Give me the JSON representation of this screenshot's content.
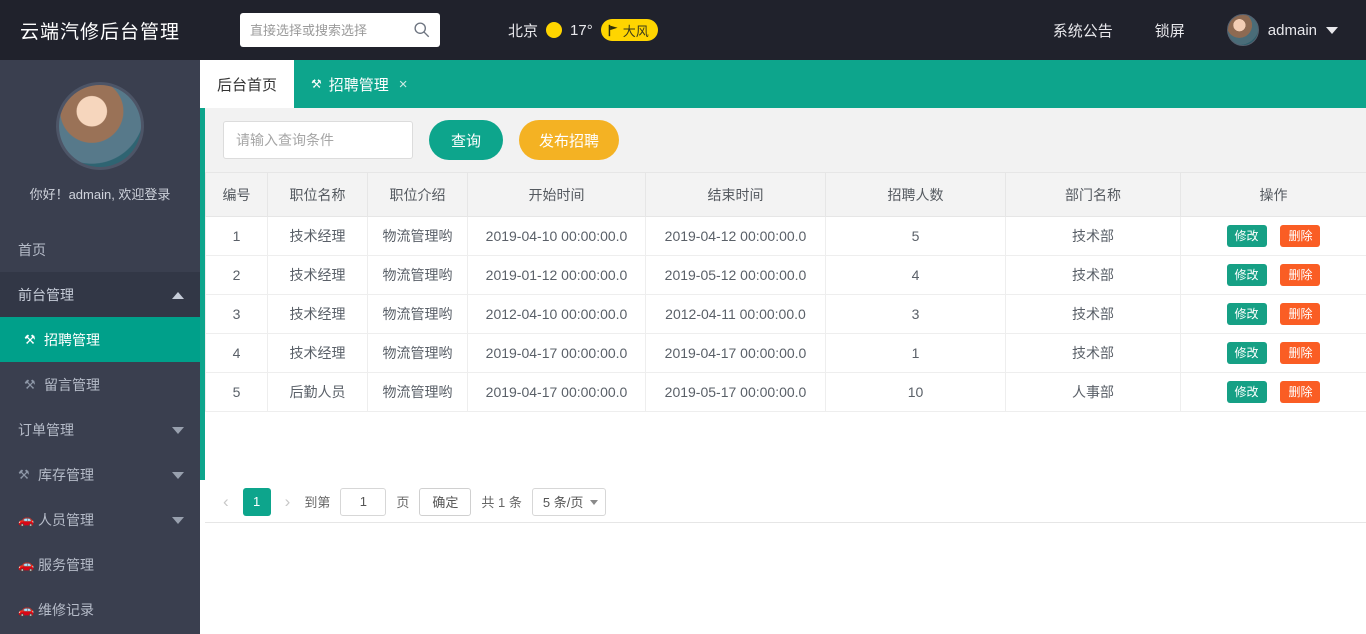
{
  "topbar": {
    "brand": "云端汽修后台管理",
    "search": {
      "value": "",
      "placeholder": "直接选择或搜索选择",
      "icon": "search-icon"
    },
    "weather": {
      "city": "北京",
      "sun_icon": "sun-icon",
      "temperature": "17°",
      "badge_icon": "flag-icon",
      "badge": "大风"
    },
    "notice": "系统公告",
    "lock": "锁屏",
    "user": "admain",
    "caret": "chevron-down-icon"
  },
  "sidebar": {
    "greeting": "你好！admain, 欢迎登录",
    "items": [
      {
        "label": "首页",
        "icon": "",
        "state": "plain",
        "arrow": ""
      },
      {
        "label": "前台管理",
        "icon": "",
        "state": "group",
        "arrow": "up"
      },
      {
        "label": "招聘管理",
        "icon": "tools-icon",
        "state": "active-sub",
        "arrow": ""
      },
      {
        "label": "留言管理",
        "icon": "tools-icon",
        "state": "sub",
        "arrow": ""
      },
      {
        "label": "订单管理",
        "icon": "",
        "state": "plain",
        "arrow": "down"
      },
      {
        "label": "库存管理",
        "icon": "tools-icon",
        "state": "plain",
        "arrow": "down"
      },
      {
        "label": "人员管理",
        "icon": "car-icon",
        "state": "plain",
        "arrow": "down"
      },
      {
        "label": "服务管理",
        "icon": "car-icon",
        "state": "plain",
        "arrow": ""
      },
      {
        "label": "维修记录",
        "icon": "car-icon",
        "state": "plain",
        "arrow": ""
      }
    ]
  },
  "tabs": [
    {
      "label": "后台首页",
      "active": false,
      "icon": "",
      "closable": false
    },
    {
      "label": "招聘管理",
      "active": true,
      "icon": "tools-icon",
      "closable": true,
      "close": "×"
    }
  ],
  "toolbar": {
    "query_value": "",
    "query_placeholder": "请输入查询条件",
    "search_label": "查询",
    "publish_label": "发布招聘"
  },
  "table": {
    "columns": [
      "编号",
      "职位名称",
      "职位介绍",
      "开始时间",
      "结束时间",
      "招聘人数",
      "部门名称",
      "操作"
    ],
    "rows": [
      {
        "id": "1",
        "position": "技术经理",
        "intro": "物流管理哟",
        "start": "2019-04-10 00:00:00.0",
        "end": "2019-04-12 00:00:00.0",
        "count": "5",
        "dept": "技术部"
      },
      {
        "id": "2",
        "position": "技术经理",
        "intro": "物流管理哟",
        "start": "2019-01-12 00:00:00.0",
        "end": "2019-05-12 00:00:00.0",
        "count": "4",
        "dept": "技术部"
      },
      {
        "id": "3",
        "position": "技术经理",
        "intro": "物流管理哟",
        "start": "2012-04-10 00:00:00.0",
        "end": "2012-04-11 00:00:00.0",
        "count": "3",
        "dept": "技术部"
      },
      {
        "id": "4",
        "position": "技术经理",
        "intro": "物流管理哟",
        "start": "2019-04-17 00:00:00.0",
        "end": "2019-04-17 00:00:00.0",
        "count": "1",
        "dept": "技术部"
      },
      {
        "id": "5",
        "position": "后勤人员",
        "intro": "物流管理哟",
        "start": "2019-04-17 00:00:00.0",
        "end": "2019-05-17 00:00:00.0",
        "count": "10",
        "dept": "人事部"
      }
    ],
    "edit_label": "修改",
    "delete_label": "删除"
  },
  "pagination": {
    "prev": "‹",
    "next": "›",
    "current_page": "1",
    "goto_prefix": "到第",
    "goto_value": "1",
    "goto_suffix": "页",
    "confirm": "确定",
    "total": "共 1 条",
    "page_size": "5 条/页"
  },
  "colors": {
    "accent_green": "#0da58c",
    "sidebar_bg": "#3a3f4f",
    "topbar_bg": "#20222c",
    "publish_orange": "#f4b223",
    "delete_orange": "#fa5d24",
    "edit_green": "#16a085",
    "weather_yellow": "#ffd500"
  }
}
